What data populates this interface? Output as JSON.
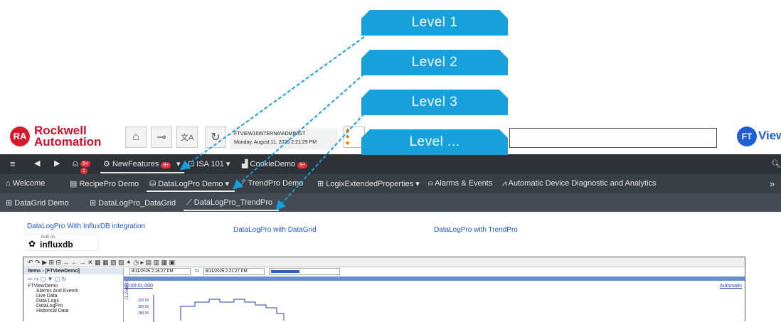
{
  "header": {
    "company_line1": "Rockwell",
    "company_line2": "Automation",
    "ra_mark": "RA",
    "user": "FTVIEW16INTERNA\\ADMINIST",
    "datetime": "Monday, August 11, 2025 2:21:29 PM",
    "ft_mark": "FT",
    "product": "View SE"
  },
  "top_nav": {
    "badge_alarm": "9+",
    "badge_small": "1",
    "tabs": [
      {
        "label": "NewFeatures",
        "badge": "9+"
      },
      {
        "label": "ISA 101"
      },
      {
        "label": "CookieDemo",
        "badge": "9+"
      }
    ]
  },
  "second_nav": {
    "items": [
      {
        "label": "Welcome"
      },
      {
        "label": "RecipePro Demo"
      },
      {
        "label": "DataLogPro Demo"
      },
      {
        "label": "TrendPro Demo"
      },
      {
        "label": "LogixExtendedProperties"
      },
      {
        "label": "Alarms & Events"
      },
      {
        "label": "Automatic Device Diagnostic and Analytics"
      }
    ]
  },
  "third_nav": {
    "items": [
      {
        "label": "DataGrid Demo"
      },
      {
        "label": "DataLogPro_DataGrid"
      },
      {
        "label": "DataLogPro_TrendPro"
      }
    ]
  },
  "content": {
    "link_influx": "DataLogPro With InfluxDB integration",
    "link_datagrid": "DataLogPro with DataGrid",
    "link_trendpro": "DataLogPro with TrendPro",
    "influx_built_on": "built on",
    "influx_name": "influxdb",
    "items_title": "Items - [FTViewDemo]",
    "tree": [
      "FTViewDemo",
      "Alarms And Events",
      "Live Data",
      "Data Logs",
      "DataLogPro",
      "Historical Data"
    ],
    "start_time": "8/11/2025 2:16:27 PM",
    "end_time": "8/11/2025 2:21:27 PM",
    "span": "00:00:01.000",
    "mode": "Automatic",
    "y_axis_label": "(1.Zone1)",
    "y_ticks": [
      "320.00",
      "300.00",
      "280.00"
    ]
  },
  "callouts": [
    "Level 1",
    "Level 2",
    "Level 3",
    "Level ..."
  ],
  "colors": {
    "callout": "#16a0dc",
    "arrow": "#16a0dc",
    "brand_red": "#c8102e",
    "ft_blue": "#1e5fd6"
  }
}
